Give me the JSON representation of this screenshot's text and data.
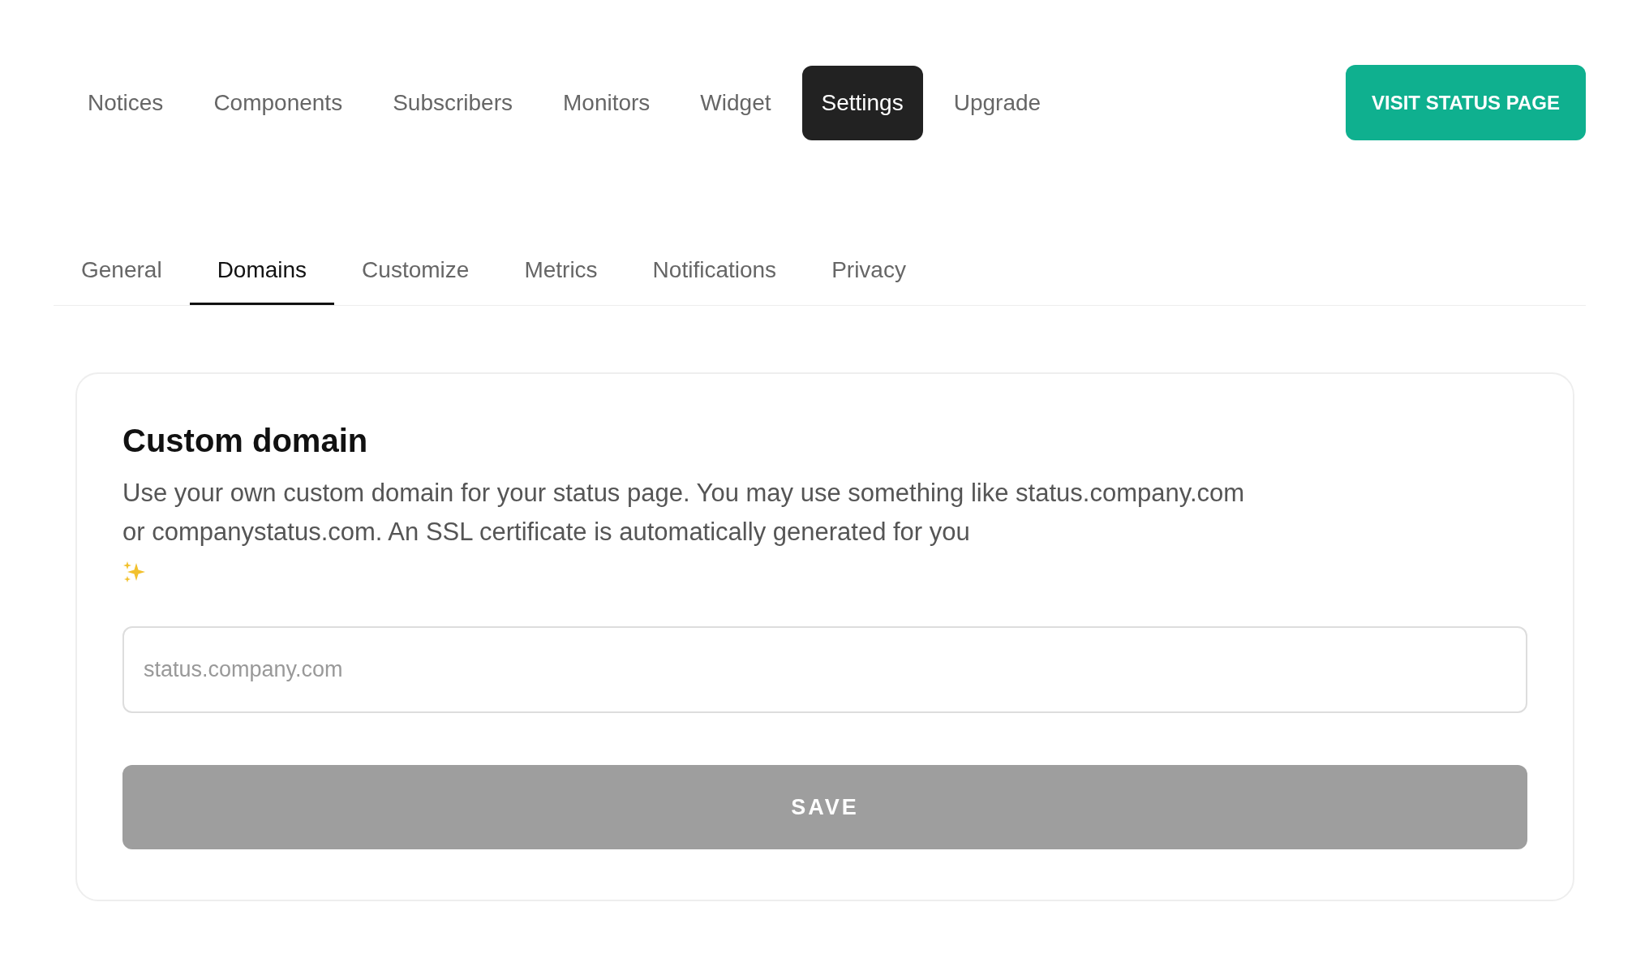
{
  "nav": {
    "items": [
      {
        "label": "Notices",
        "selected": false
      },
      {
        "label": "Components",
        "selected": false
      },
      {
        "label": "Subscribers",
        "selected": false
      },
      {
        "label": "Monitors",
        "selected": false
      },
      {
        "label": "Widget",
        "selected": false
      },
      {
        "label": "Settings",
        "selected": true
      },
      {
        "label": "Upgrade",
        "selected": false
      }
    ],
    "action": "VISIT STATUS PAGE"
  },
  "tabs": [
    {
      "label": "General",
      "selected": false
    },
    {
      "label": "Domains",
      "selected": true
    },
    {
      "label": "Customize",
      "selected": false
    },
    {
      "label": "Metrics",
      "selected": false
    },
    {
      "label": "Notifications",
      "selected": false
    },
    {
      "label": "Privacy",
      "selected": false
    }
  ],
  "card": {
    "title": "Custom domain",
    "description": "Use your own custom domain for your status page. You may use something like status.company.com or companystatus.com. An SSL certificate is automatically generated for you",
    "domain_field": {
      "placeholder": "status.company.com"
    },
    "save_button": {
      "label": "SAVE",
      "disabled": true
    }
  }
}
